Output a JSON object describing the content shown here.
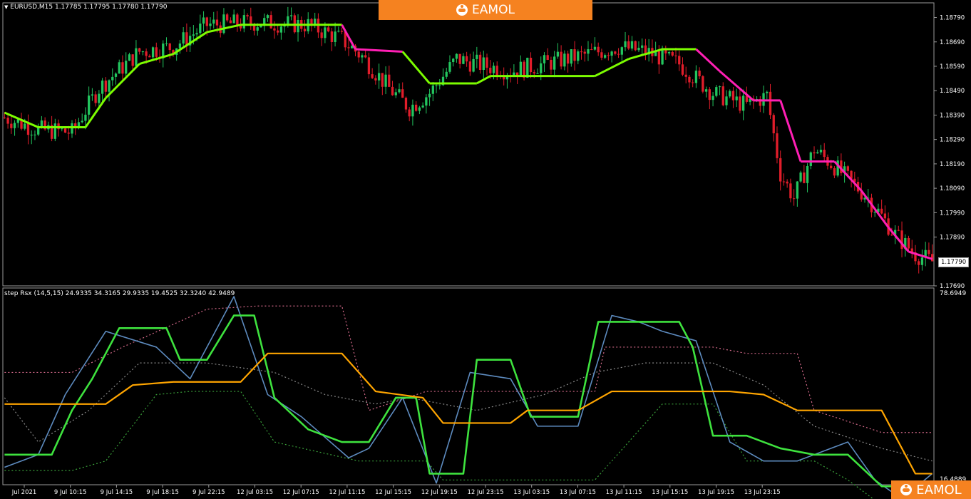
{
  "window": {
    "symbol_info": "EURUSD,M15  1.17785 1.17795 1.17780 1.17790",
    "collapse_glyph": "▼"
  },
  "brand": {
    "name": "EAMOL",
    "accent": "#f58220"
  },
  "price_axis": {
    "ticks": [
      "1.18790",
      "1.18690",
      "1.18590",
      "1.18490",
      "1.18390",
      "1.18290",
      "1.18190",
      "1.18090",
      "1.17990",
      "1.17890",
      "1.17690"
    ],
    "current_price": "1.17790"
  },
  "indicator": {
    "label": "step Rsx (14,5,15) 24.9335 34.3165 29.9335 19.4525 32.3240 42.9489",
    "max": "78.6949",
    "min": "16.4889"
  },
  "time_axis": {
    "ticks": [
      "Jul 2021",
      "9 Jul 10:15",
      "9 Jul 14:15",
      "9 Jul 18:15",
      "9 Jul 22:15",
      "12 Jul 03:15",
      "12 Jul 07:15",
      "12 Jul 11:15",
      "12 Jul 15:15",
      "12 Jul 19:15",
      "12 Jul 23:15",
      "13 Jul 03:15",
      "13 Jul 07:15",
      "13 Jul 11:15",
      "13 Jul 15:15",
      "13 Jul 19:15",
      "13 Jul 23:15"
    ]
  },
  "colors": {
    "bull": "#22c55e",
    "bear": "#e11d2a",
    "step_up": "#7CFC00",
    "step_down": "#ff1fb4",
    "rsx_fast": "#5d8bbf",
    "rsx_step": "#3ee23e",
    "rsx_slow": "#ffa500",
    "band_upper": "#d46a8a",
    "band_lower": "#3aa03a",
    "band_mid": "#888888"
  },
  "chart_data": [
    {
      "type": "candlestick",
      "title": "EURUSD,M15",
      "ylim": [
        1.1769,
        1.1885
      ],
      "close_anchors": [
        [
          0,
          1.1838
        ],
        [
          10,
          1.1833
        ],
        [
          20,
          1.1832
        ],
        [
          28,
          1.185
        ],
        [
          40,
          1.1865
        ],
        [
          50,
          1.1867
        ],
        [
          60,
          1.1876
        ],
        [
          75,
          1.1877
        ],
        [
          90,
          1.1876
        ],
        [
          100,
          1.187
        ],
        [
          106,
          1.1863
        ],
        [
          114,
          1.185
        ],
        [
          120,
          1.1842
        ],
        [
          126,
          1.1848
        ],
        [
          134,
          1.1862
        ],
        [
          140,
          1.186
        ],
        [
          150,
          1.1857
        ],
        [
          160,
          1.186
        ],
        [
          170,
          1.1863
        ],
        [
          182,
          1.1867
        ],
        [
          190,
          1.1865
        ],
        [
          200,
          1.186
        ],
        [
          210,
          1.1848
        ],
        [
          220,
          1.1843
        ],
        [
          226,
          1.1847
        ],
        [
          230,
          1.1815
        ],
        [
          234,
          1.1805
        ],
        [
          240,
          1.1825
        ],
        [
          246,
          1.1818
        ],
        [
          256,
          1.1805
        ],
        [
          264,
          1.179
        ],
        [
          270,
          1.1782
        ],
        [
          275,
          1.1779
        ]
      ],
      "step_line": [
        [
          0,
          1.184,
          "down"
        ],
        [
          10,
          1.1834,
          "up"
        ],
        [
          24,
          1.1834,
          "up"
        ],
        [
          30,
          1.1846,
          "up"
        ],
        [
          40,
          1.186,
          "up"
        ],
        [
          50,
          1.1864,
          "up"
        ],
        [
          60,
          1.1873,
          "up"
        ],
        [
          70,
          1.1876,
          "up"
        ],
        [
          100,
          1.1876,
          "up"
        ],
        [
          104,
          1.1866,
          "down"
        ],
        [
          118,
          1.1865,
          "down"
        ],
        [
          126,
          1.1852,
          "up"
        ],
        [
          140,
          1.1852,
          "up"
        ],
        [
          144,
          1.1855,
          "up"
        ],
        [
          175,
          1.1855,
          "up"
        ],
        [
          185,
          1.1862,
          "up"
        ],
        [
          195,
          1.1866,
          "up"
        ],
        [
          205,
          1.1866,
          "up"
        ],
        [
          212,
          1.1857,
          "down"
        ],
        [
          222,
          1.1845,
          "down"
        ],
        [
          230,
          1.1845,
          "down"
        ],
        [
          236,
          1.182,
          "down"
        ],
        [
          246,
          1.182,
          "down"
        ],
        [
          254,
          1.1808,
          "down"
        ],
        [
          262,
          1.1793,
          "down"
        ],
        [
          268,
          1.1783,
          "down"
        ],
        [
          275,
          1.178,
          "down"
        ]
      ]
    },
    {
      "type": "line",
      "title": "step Rsx (14,5,15)",
      "ylim": [
        16.4889,
        78.6949
      ],
      "series": [
        {
          "id": "band_upper",
          "values": [
            [
              0,
              52
            ],
            [
              20,
              52
            ],
            [
              35,
              60
            ],
            [
              60,
              72
            ],
            [
              75,
              73
            ],
            [
              100,
              73
            ],
            [
              108,
              40
            ],
            [
              125,
              46
            ],
            [
              150,
              46
            ],
            [
              175,
              46
            ],
            [
              178,
              60
            ],
            [
              210,
              60
            ],
            [
              220,
              58
            ],
            [
              235,
              58
            ],
            [
              240,
              40
            ],
            [
              260,
              33
            ],
            [
              275,
              33
            ]
          ]
        },
        {
          "id": "band_mid",
          "values": [
            [
              0,
              44
            ],
            [
              10,
              30
            ],
            [
              25,
              40
            ],
            [
              40,
              55
            ],
            [
              60,
              55
            ],
            [
              80,
              52
            ],
            [
              95,
              45
            ],
            [
              110,
              42
            ],
            [
              120,
              44
            ],
            [
              140,
              40
            ],
            [
              160,
              45
            ],
            [
              175,
              52
            ],
            [
              190,
              55
            ],
            [
              210,
              55
            ],
            [
              225,
              48
            ],
            [
              240,
              35
            ],
            [
              260,
              28
            ],
            [
              275,
              24
            ]
          ]
        },
        {
          "id": "band_lower",
          "values": [
            [
              0,
              21
            ],
            [
              20,
              21
            ],
            [
              30,
              24
            ],
            [
              45,
              45
            ],
            [
              55,
              46
            ],
            [
              70,
              46
            ],
            [
              80,
              30
            ],
            [
              105,
              24
            ],
            [
              125,
              24
            ],
            [
              130,
              18
            ],
            [
              160,
              18
            ],
            [
              175,
              18
            ],
            [
              195,
              42
            ],
            [
              210,
              42
            ],
            [
              220,
              24
            ],
            [
              240,
              24
            ],
            [
              250,
              18
            ],
            [
              260,
              10
            ],
            [
              275,
              10
            ]
          ]
        },
        {
          "id": "rsx_fast",
          "values": [
            [
              0,
              22
            ],
            [
              10,
              26
            ],
            [
              18,
              45
            ],
            [
              30,
              65
            ],
            [
              45,
              60
            ],
            [
              55,
              50
            ],
            [
              68,
              76
            ],
            [
              78,
              45
            ],
            [
              88,
              38
            ],
            [
              102,
              25
            ],
            [
              108,
              28
            ],
            [
              118,
              44
            ],
            [
              128,
              17
            ],
            [
              138,
              52
            ],
            [
              150,
              50
            ],
            [
              158,
              35
            ],
            [
              170,
              35
            ],
            [
              180,
              70
            ],
            [
              188,
              68
            ],
            [
              195,
              65
            ],
            [
              205,
              62
            ],
            [
              215,
              30
            ],
            [
              225,
              24
            ],
            [
              235,
              24
            ],
            [
              245,
              28
            ],
            [
              250,
              30
            ],
            [
              258,
              18
            ],
            [
              266,
              12
            ],
            [
              275,
              20
            ]
          ]
        },
        {
          "id": "rsx_step",
          "values": [
            [
              0,
              26
            ],
            [
              14,
              26
            ],
            [
              20,
              40
            ],
            [
              26,
              50
            ],
            [
              34,
              66
            ],
            [
              48,
              66
            ],
            [
              52,
              56
            ],
            [
              60,
              56
            ],
            [
              68,
              70
            ],
            [
              74,
              70
            ],
            [
              80,
              44
            ],
            [
              90,
              34
            ],
            [
              100,
              30
            ],
            [
              108,
              30
            ],
            [
              116,
              44
            ],
            [
              122,
              44
            ],
            [
              126,
              20
            ],
            [
              136,
              20
            ],
            [
              140,
              56
            ],
            [
              150,
              56
            ],
            [
              156,
              38
            ],
            [
              170,
              38
            ],
            [
              176,
              68
            ],
            [
              200,
              68
            ],
            [
              204,
              60
            ],
            [
              210,
              32
            ],
            [
              220,
              32
            ],
            [
              230,
              28
            ],
            [
              240,
              26
            ],
            [
              250,
              26
            ],
            [
              260,
              16
            ],
            [
              268,
              16
            ],
            [
              275,
              16
            ]
          ]
        },
        {
          "id": "rsx_slow",
          "values": [
            [
              0,
              42
            ],
            [
              30,
              42
            ],
            [
              38,
              48
            ],
            [
              50,
              49
            ],
            [
              70,
              49
            ],
            [
              78,
              58
            ],
            [
              100,
              58
            ],
            [
              110,
              46
            ],
            [
              124,
              44
            ],
            [
              130,
              36
            ],
            [
              150,
              36
            ],
            [
              155,
              40
            ],
            [
              170,
              40
            ],
            [
              180,
              46
            ],
            [
              200,
              46
            ],
            [
              215,
              46
            ],
            [
              225,
              45
            ],
            [
              235,
              40
            ],
            [
              250,
              40
            ],
            [
              260,
              40
            ],
            [
              270,
              20
            ],
            [
              275,
              20
            ]
          ]
        }
      ]
    }
  ]
}
